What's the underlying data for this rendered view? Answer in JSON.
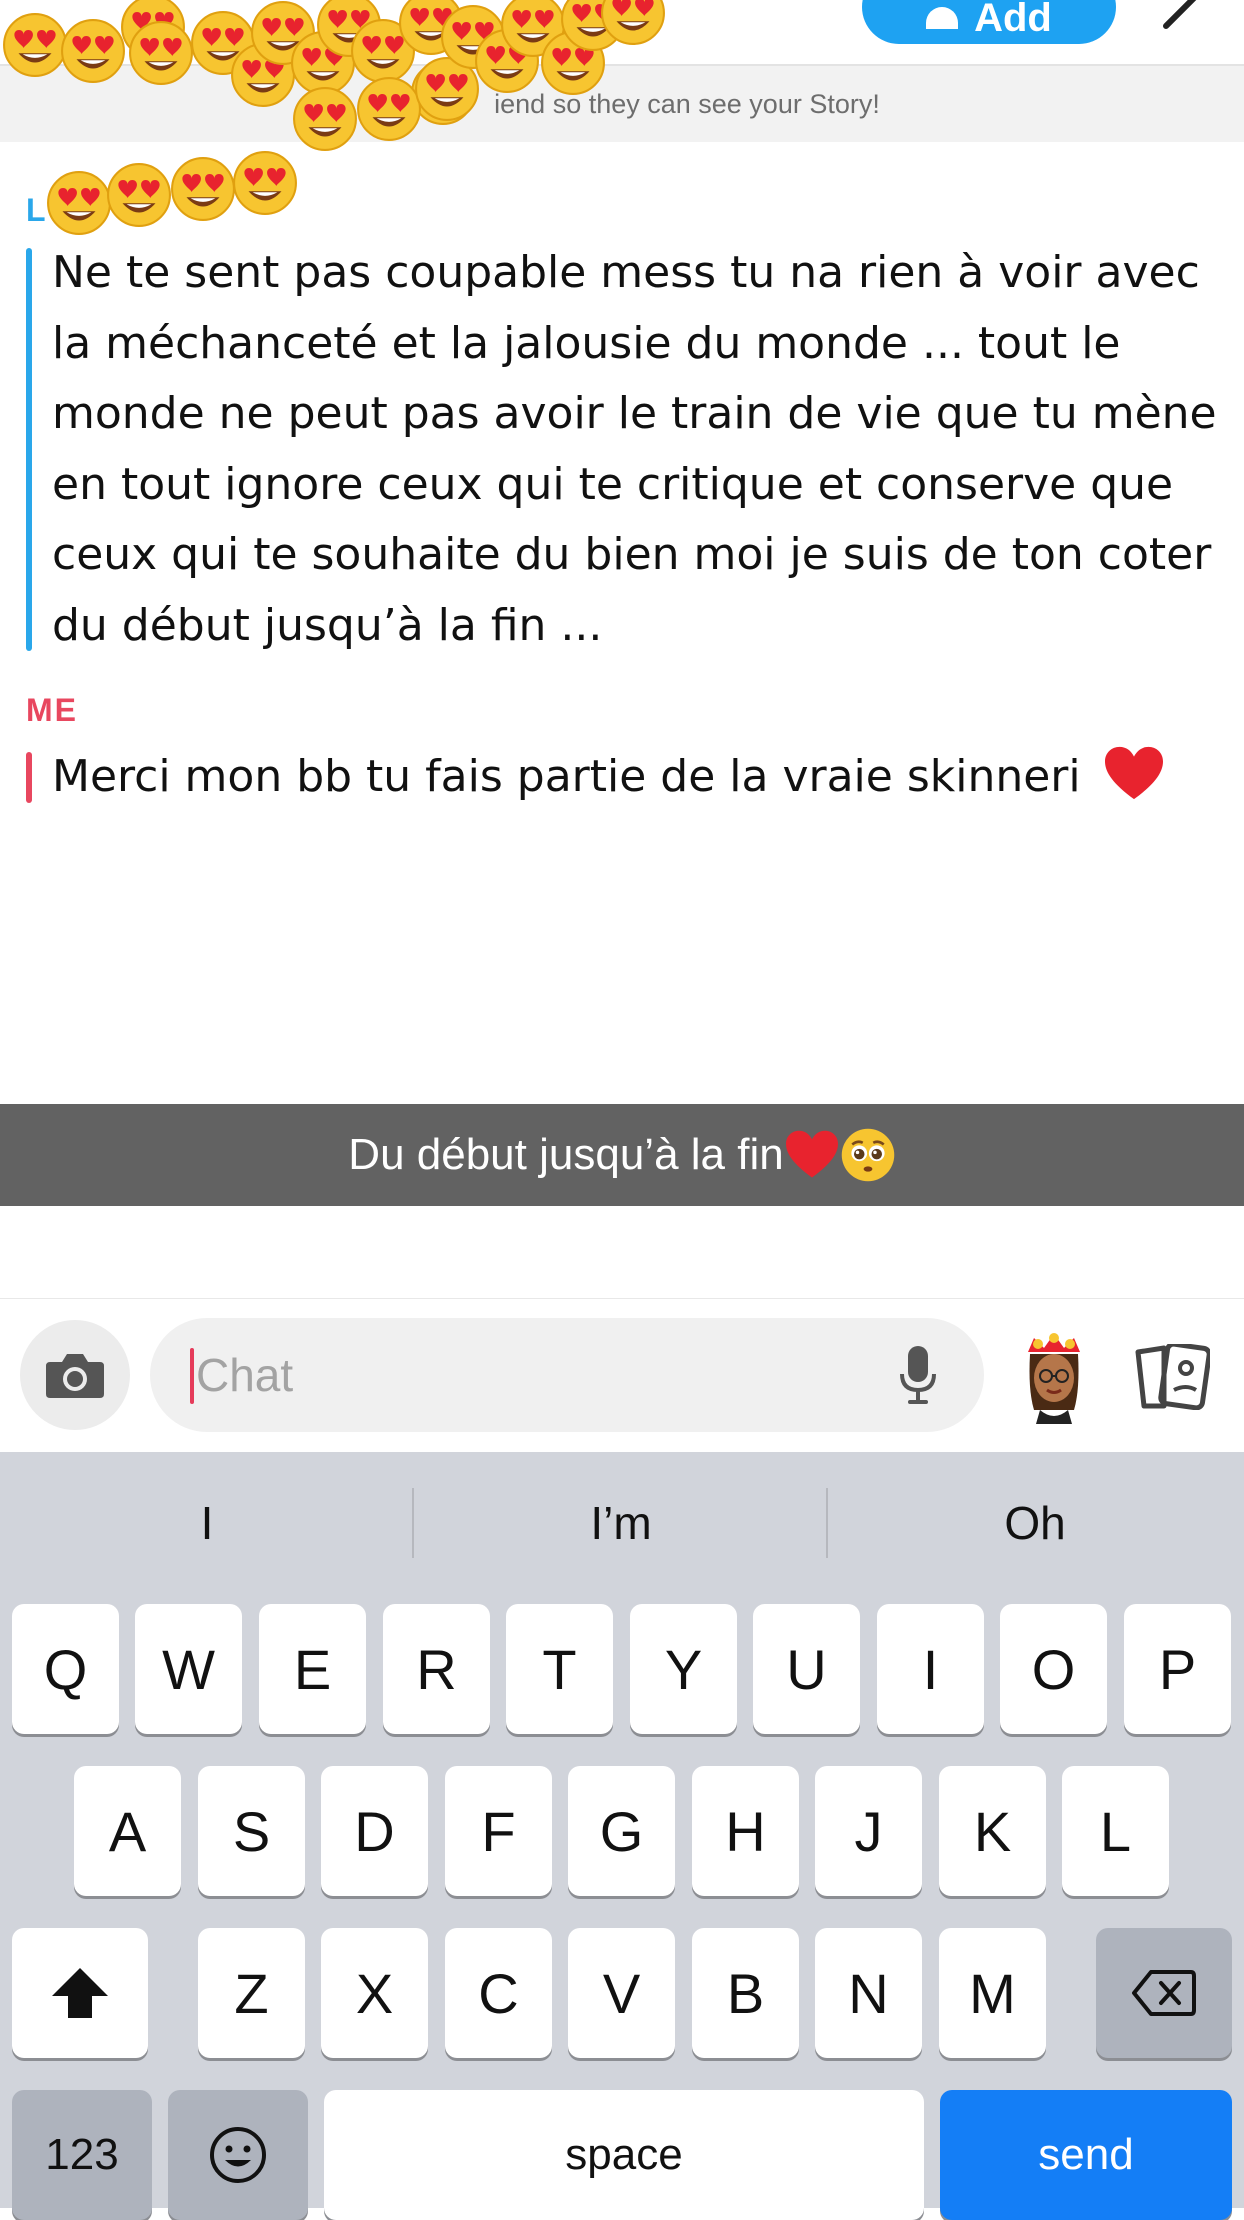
{
  "header": {
    "add_label": "Add",
    "banner_text": "iend so they can see your Story!"
  },
  "chat": {
    "messages": [
      {
        "sender": "L",
        "sender_color": "#2aa7ea",
        "text": "Ne te sent pas coupable mess tu na rien à voir avec la méchanceté et la jalousie du monde ... tout le monde ne peut pas avoir le train de vie que tu mène en tout ignore ceux qui te critique  et conserve que ceux qui te souhaite du bien moi je suis de ton coter du début jusqu’à la fin ..."
      },
      {
        "sender": "ME",
        "sender_color": "#e8475f",
        "text": "Merci mon bb tu fais partie de la vraie skinneri",
        "emoji": "red-heart"
      }
    ]
  },
  "caption": {
    "text": "Du début jusqu’à la fin",
    "emojis": [
      "red-heart",
      "pleading-face"
    ]
  },
  "composer": {
    "placeholder": "Chat",
    "icons": [
      "camera-icon",
      "microphone-icon",
      "bitmoji-avatar",
      "cards-icon"
    ]
  },
  "keyboard": {
    "suggestions": [
      "I",
      "I’m",
      "Oh"
    ],
    "row1": [
      "Q",
      "W",
      "E",
      "R",
      "T",
      "Y",
      "U",
      "I",
      "O",
      "P"
    ],
    "row2": [
      "A",
      "S",
      "D",
      "F",
      "G",
      "H",
      "J",
      "K",
      "L"
    ],
    "row3": [
      "Z",
      "X",
      "C",
      "V",
      "B",
      "N",
      "M"
    ],
    "numbers_label": "123",
    "space_label": "space",
    "send_label": "send"
  },
  "colors": {
    "accent_blue": "#1ea2f2",
    "send_blue": "#147ef6",
    "friend_bar": "#2aa7ea",
    "me_bar": "#e8475f"
  }
}
